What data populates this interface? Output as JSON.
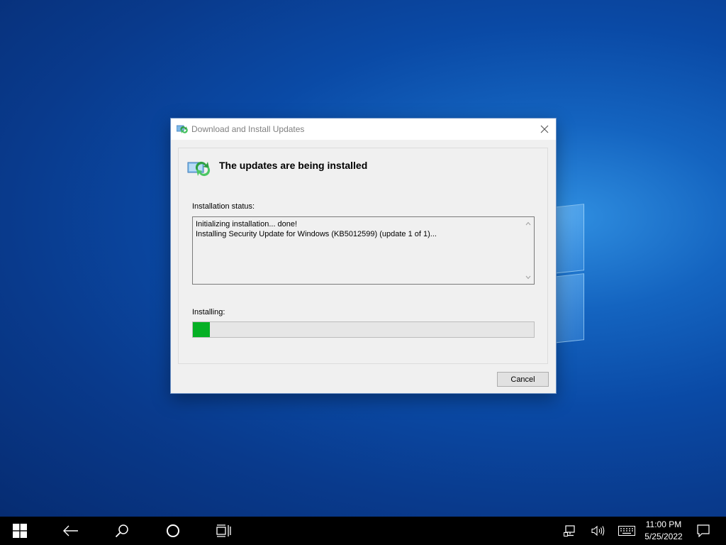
{
  "dialog": {
    "title": "Download and Install Updates",
    "heading": "The updates are being installed",
    "status_label": "Installation status:",
    "status_lines": [
      "Initializing installation... done!",
      "Installing Security Update for Windows (KB5012599) (update 1 of 1)..."
    ],
    "progress_label": "Installing:",
    "progress_fraction": 0.05,
    "progress_color": "#06b025",
    "cancel_label": "Cancel",
    "close_icon": "close-icon",
    "title_icon": "windows-update-icon"
  },
  "taskbar": {
    "start_icon": "windows-start-icon",
    "back_icon": "back-arrow-icon",
    "search_icon": "search-icon",
    "cortana_icon": "cortana-circle-icon",
    "task_view_icon": "task-view-icon",
    "network_icon": "network-icon",
    "volume_icon": "volume-icon",
    "keyboard_icon": "touch-keyboard-icon",
    "notification_icon": "action-center-icon",
    "time": "11:00 PM",
    "date": "5/25/2022"
  }
}
